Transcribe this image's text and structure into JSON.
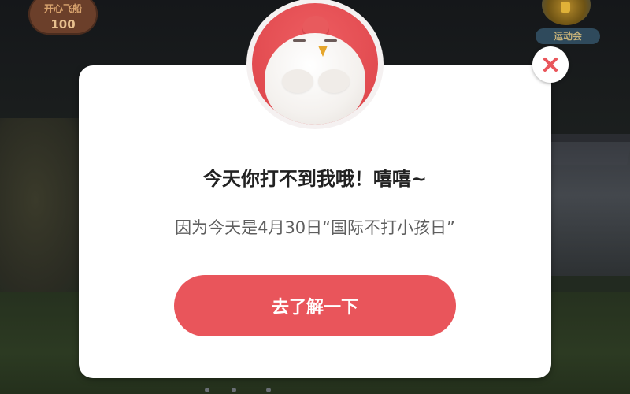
{
  "top_left_badge": {
    "title": "开心飞船",
    "value": "100"
  },
  "top_right_badge": {
    "label": "运动会",
    "icon": "coin-icon"
  },
  "modal": {
    "title": "今天你打不到我哦！嘻嘻~",
    "subtitle": "因为今天是4月30日“国际不打小孩日”",
    "cta_label": "去了解一下",
    "close_icon": "close-icon",
    "avatar_icon": "chick-avatar"
  },
  "colors": {
    "accent": "#e9555b",
    "avatar_bg": "#e14a4f",
    "close_x": "#e9555b"
  }
}
